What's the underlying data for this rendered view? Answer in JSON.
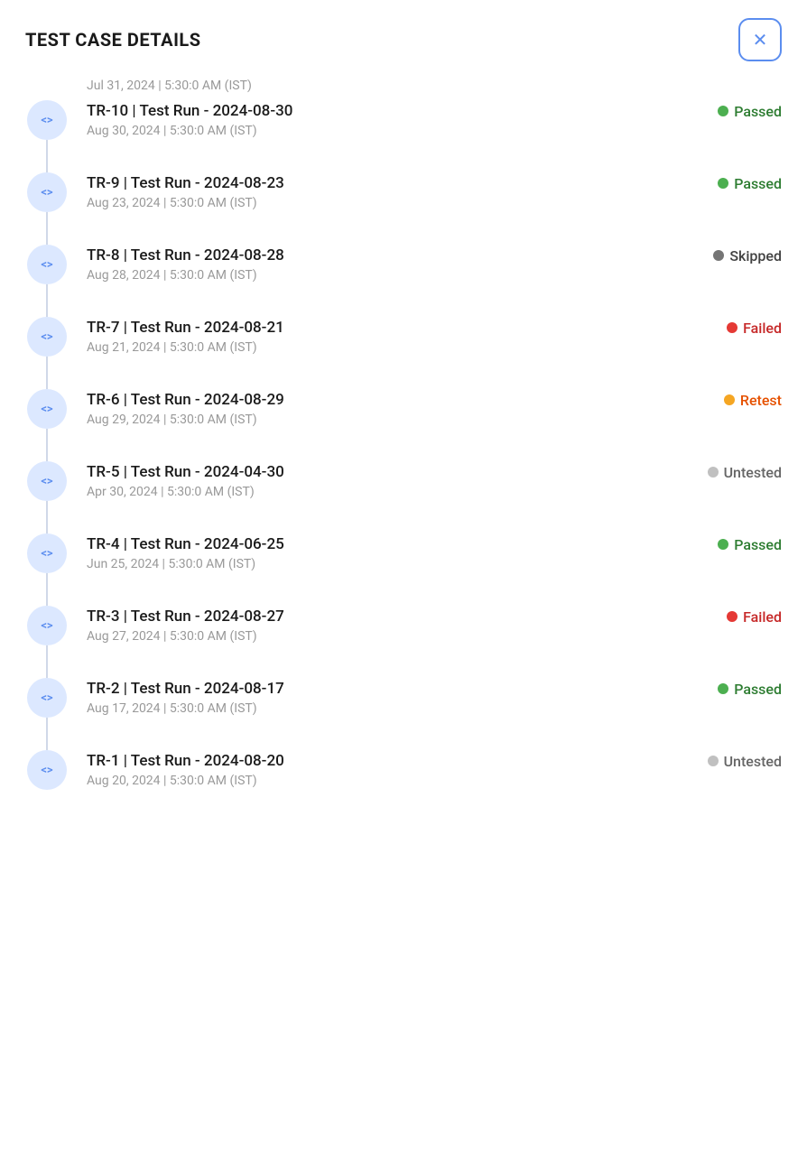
{
  "header": {
    "title": "TEST CASE DETAILS",
    "close_label": "×"
  },
  "truncated_top": "Jul 31, 2024 | 5:30:0 AM (IST)",
  "items": [
    {
      "id": "TR-10",
      "title": "TR-10 | Test Run - 2024-08-30",
      "date": "Aug 30, 2024 | 5:30:0 AM (IST)",
      "status": "Passed",
      "status_key": "passed"
    },
    {
      "id": "TR-9",
      "title": "TR-9 | Test Run - 2024-08-23",
      "date": "Aug 23, 2024 | 5:30:0 AM (IST)",
      "status": "Passed",
      "status_key": "passed"
    },
    {
      "id": "TR-8",
      "title": "TR-8 | Test Run - 2024-08-28",
      "date": "Aug 28, 2024 | 5:30:0 AM (IST)",
      "status": "Skipped",
      "status_key": "skipped"
    },
    {
      "id": "TR-7",
      "title": "TR-7 | Test Run - 2024-08-21",
      "date": "Aug 21, 2024 | 5:30:0 AM (IST)",
      "status": "Failed",
      "status_key": "failed"
    },
    {
      "id": "TR-6",
      "title": "TR-6 | Test Run - 2024-08-29",
      "date": "Aug 29, 2024 | 5:30:0 AM (IST)",
      "status": "Retest",
      "status_key": "retest"
    },
    {
      "id": "TR-5",
      "title": "TR-5 | Test Run - 2024-04-30",
      "date": "Apr 30, 2024 | 5:30:0 AM (IST)",
      "status": "Untested",
      "status_key": "untested"
    },
    {
      "id": "TR-4",
      "title": "TR-4 | Test Run - 2024-06-25",
      "date": "Jun 25, 2024 | 5:30:0 AM (IST)",
      "status": "Passed",
      "status_key": "passed"
    },
    {
      "id": "TR-3",
      "title": "TR-3 | Test Run - 2024-08-27",
      "date": "Aug 27, 2024 | 5:30:0 AM (IST)",
      "status": "Failed",
      "status_key": "failed"
    },
    {
      "id": "TR-2",
      "title": "TR-2 | Test Run - 2024-08-17",
      "date": "Aug 17, 2024 | 5:30:0 AM (IST)",
      "status": "Passed",
      "status_key": "passed"
    },
    {
      "id": "TR-1",
      "title": "TR-1 | Test Run - 2024-08-20",
      "date": "Aug 20, 2024 | 5:30:0 AM (IST)",
      "status": "Untested",
      "status_key": "untested"
    }
  ],
  "icon_label": "<>"
}
